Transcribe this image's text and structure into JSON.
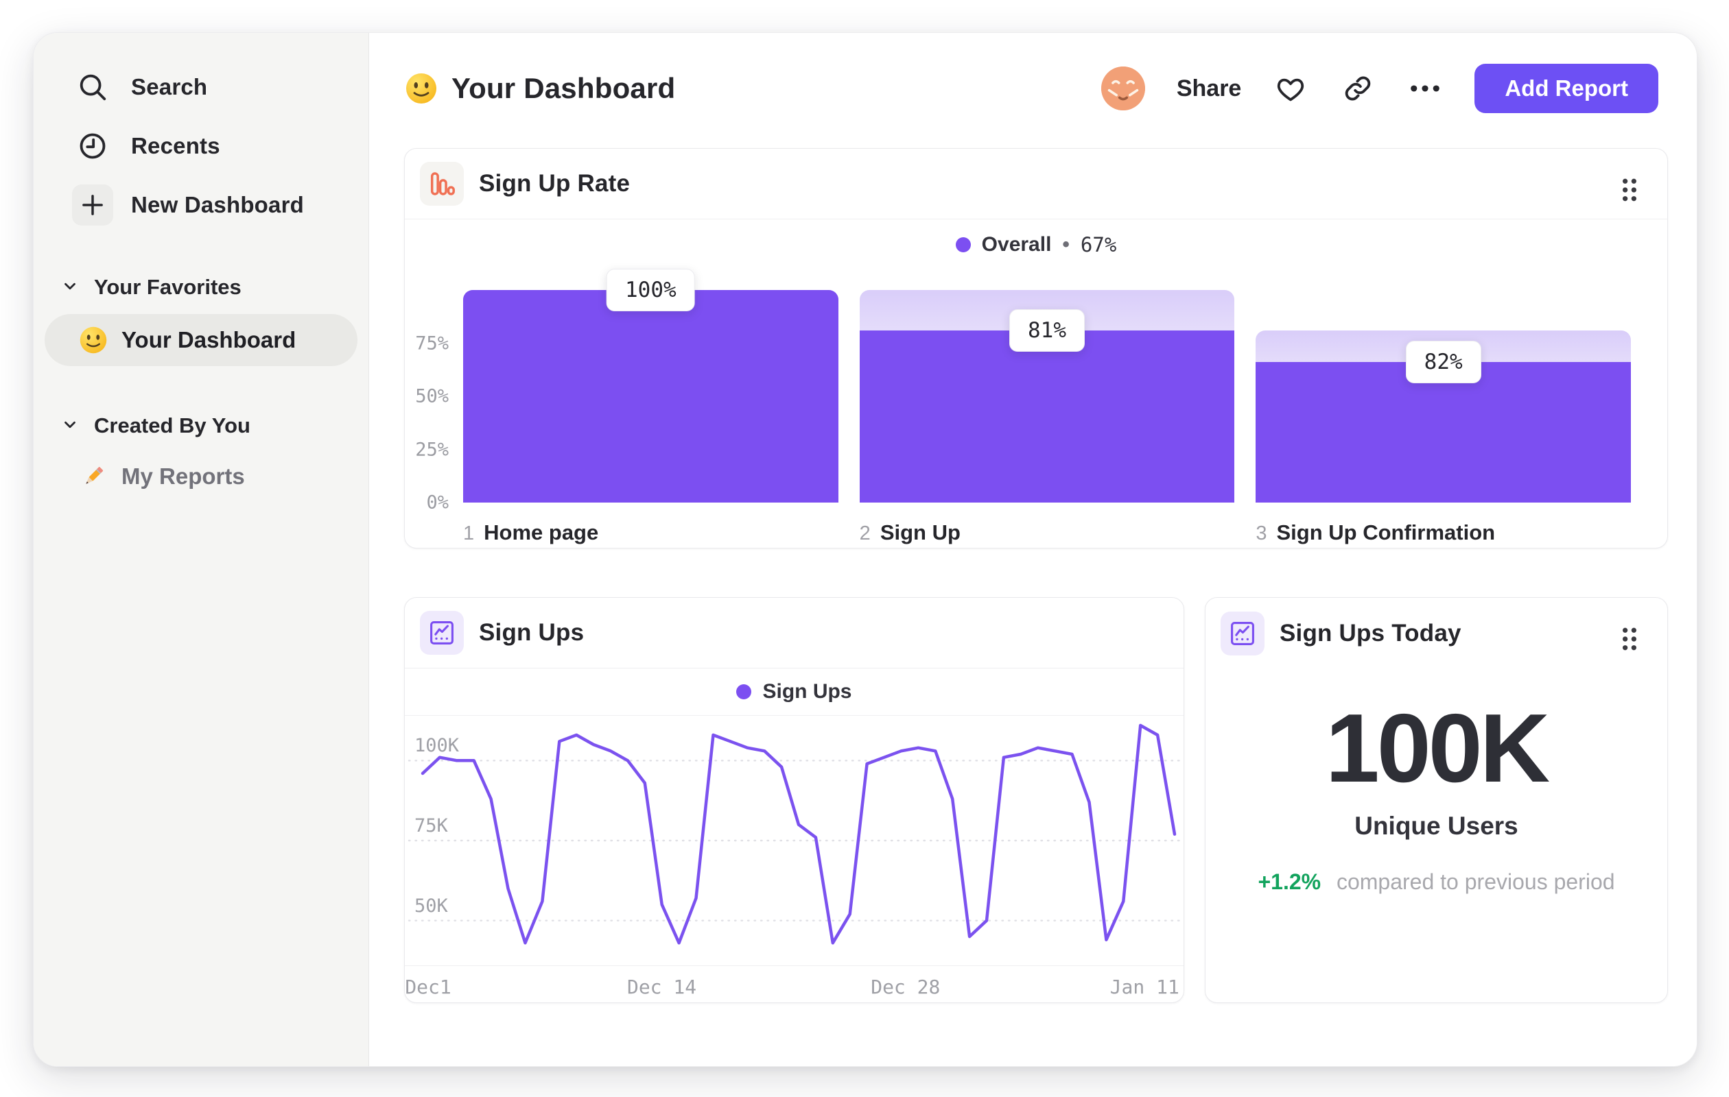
{
  "sidebar": {
    "items": [
      {
        "label": "Search",
        "icon": "search-icon"
      },
      {
        "label": "Recents",
        "icon": "clock-icon"
      },
      {
        "label": "New Dashboard",
        "icon": "plus-icon"
      }
    ],
    "favorites_section": {
      "label": "Your Favorites"
    },
    "favorite_item": {
      "label": "Your Dashboard",
      "icon": "smiley-emoji"
    },
    "created_section": {
      "label": "Created By You"
    },
    "created_item": {
      "label": "My Reports",
      "icon": "pencil-emoji"
    }
  },
  "header": {
    "title": "Your Dashboard",
    "title_icon": "smiley-emoji",
    "share_label": "Share",
    "add_report_label": "Add Report"
  },
  "colors": {
    "accent_purple": "#7c4ff1",
    "button_purple": "#6d50f4",
    "funnel_ghost_top": "#d9cdf9",
    "line_stroke": "#7b52ef",
    "positive_green": "#12a35d",
    "icon_orange": "#f07054",
    "sidebar_bg": "#f5f5f3"
  },
  "chart_data": [
    {
      "type": "bar",
      "subtype": "funnel",
      "title": "Sign Up Rate",
      "legend": {
        "series": "Overall",
        "separator": "•",
        "value": "67%"
      },
      "ylabel_ticks": [
        {
          "label": "75%",
          "pct": 75
        },
        {
          "label": "50%",
          "pct": 50
        },
        {
          "label": "25%",
          "pct": 25
        },
        {
          "label": "0%",
          "pct": 0
        }
      ],
      "ylim": [
        0,
        100
      ],
      "steps": [
        {
          "index": "1",
          "label": "Home page",
          "conversion_label": "100%",
          "column_total_pct": 100,
          "value_pct": 100
        },
        {
          "index": "2",
          "label": "Sign Up",
          "conversion_label": "81%",
          "column_total_pct": 100,
          "value_pct": 81
        },
        {
          "index": "3",
          "label": "Sign Up Confirmation",
          "conversion_label": "82%",
          "column_total_pct": 81,
          "value_pct": 66
        }
      ]
    },
    {
      "type": "line",
      "title": "Sign Ups",
      "legend": "Sign Ups",
      "xlabel_ticks": [
        {
          "label": "Dec1",
          "pos_pct": 3
        },
        {
          "label": "Dec 14",
          "pos_pct": 33
        },
        {
          "label": "Dec 28",
          "pos_pct": 64.3
        },
        {
          "label": "Jan 11",
          "pos_pct": 95
        }
      ],
      "y_ticks": [
        {
          "label": "100K",
          "value": 100
        },
        {
          "label": "75K",
          "value": 75
        },
        {
          "label": "50K",
          "value": 50
        }
      ],
      "ylim": [
        36,
        114
      ],
      "unit": "K",
      "values": [
        96,
        101,
        100,
        100,
        88,
        60,
        43,
        56,
        106,
        108,
        105,
        103,
        100,
        93,
        55,
        43,
        57,
        108,
        106,
        104,
        103,
        98,
        80,
        76,
        43,
        52,
        99,
        101,
        103,
        104,
        103,
        88,
        45,
        50,
        101,
        102,
        104,
        103,
        102,
        87,
        44,
        56,
        111,
        108,
        77
      ]
    },
    {
      "type": "big-number",
      "title": "Sign Ups Today",
      "value": "100K",
      "value_label": "Unique Users",
      "delta": "+1.2%",
      "delta_note": "compared to previous period"
    }
  ]
}
